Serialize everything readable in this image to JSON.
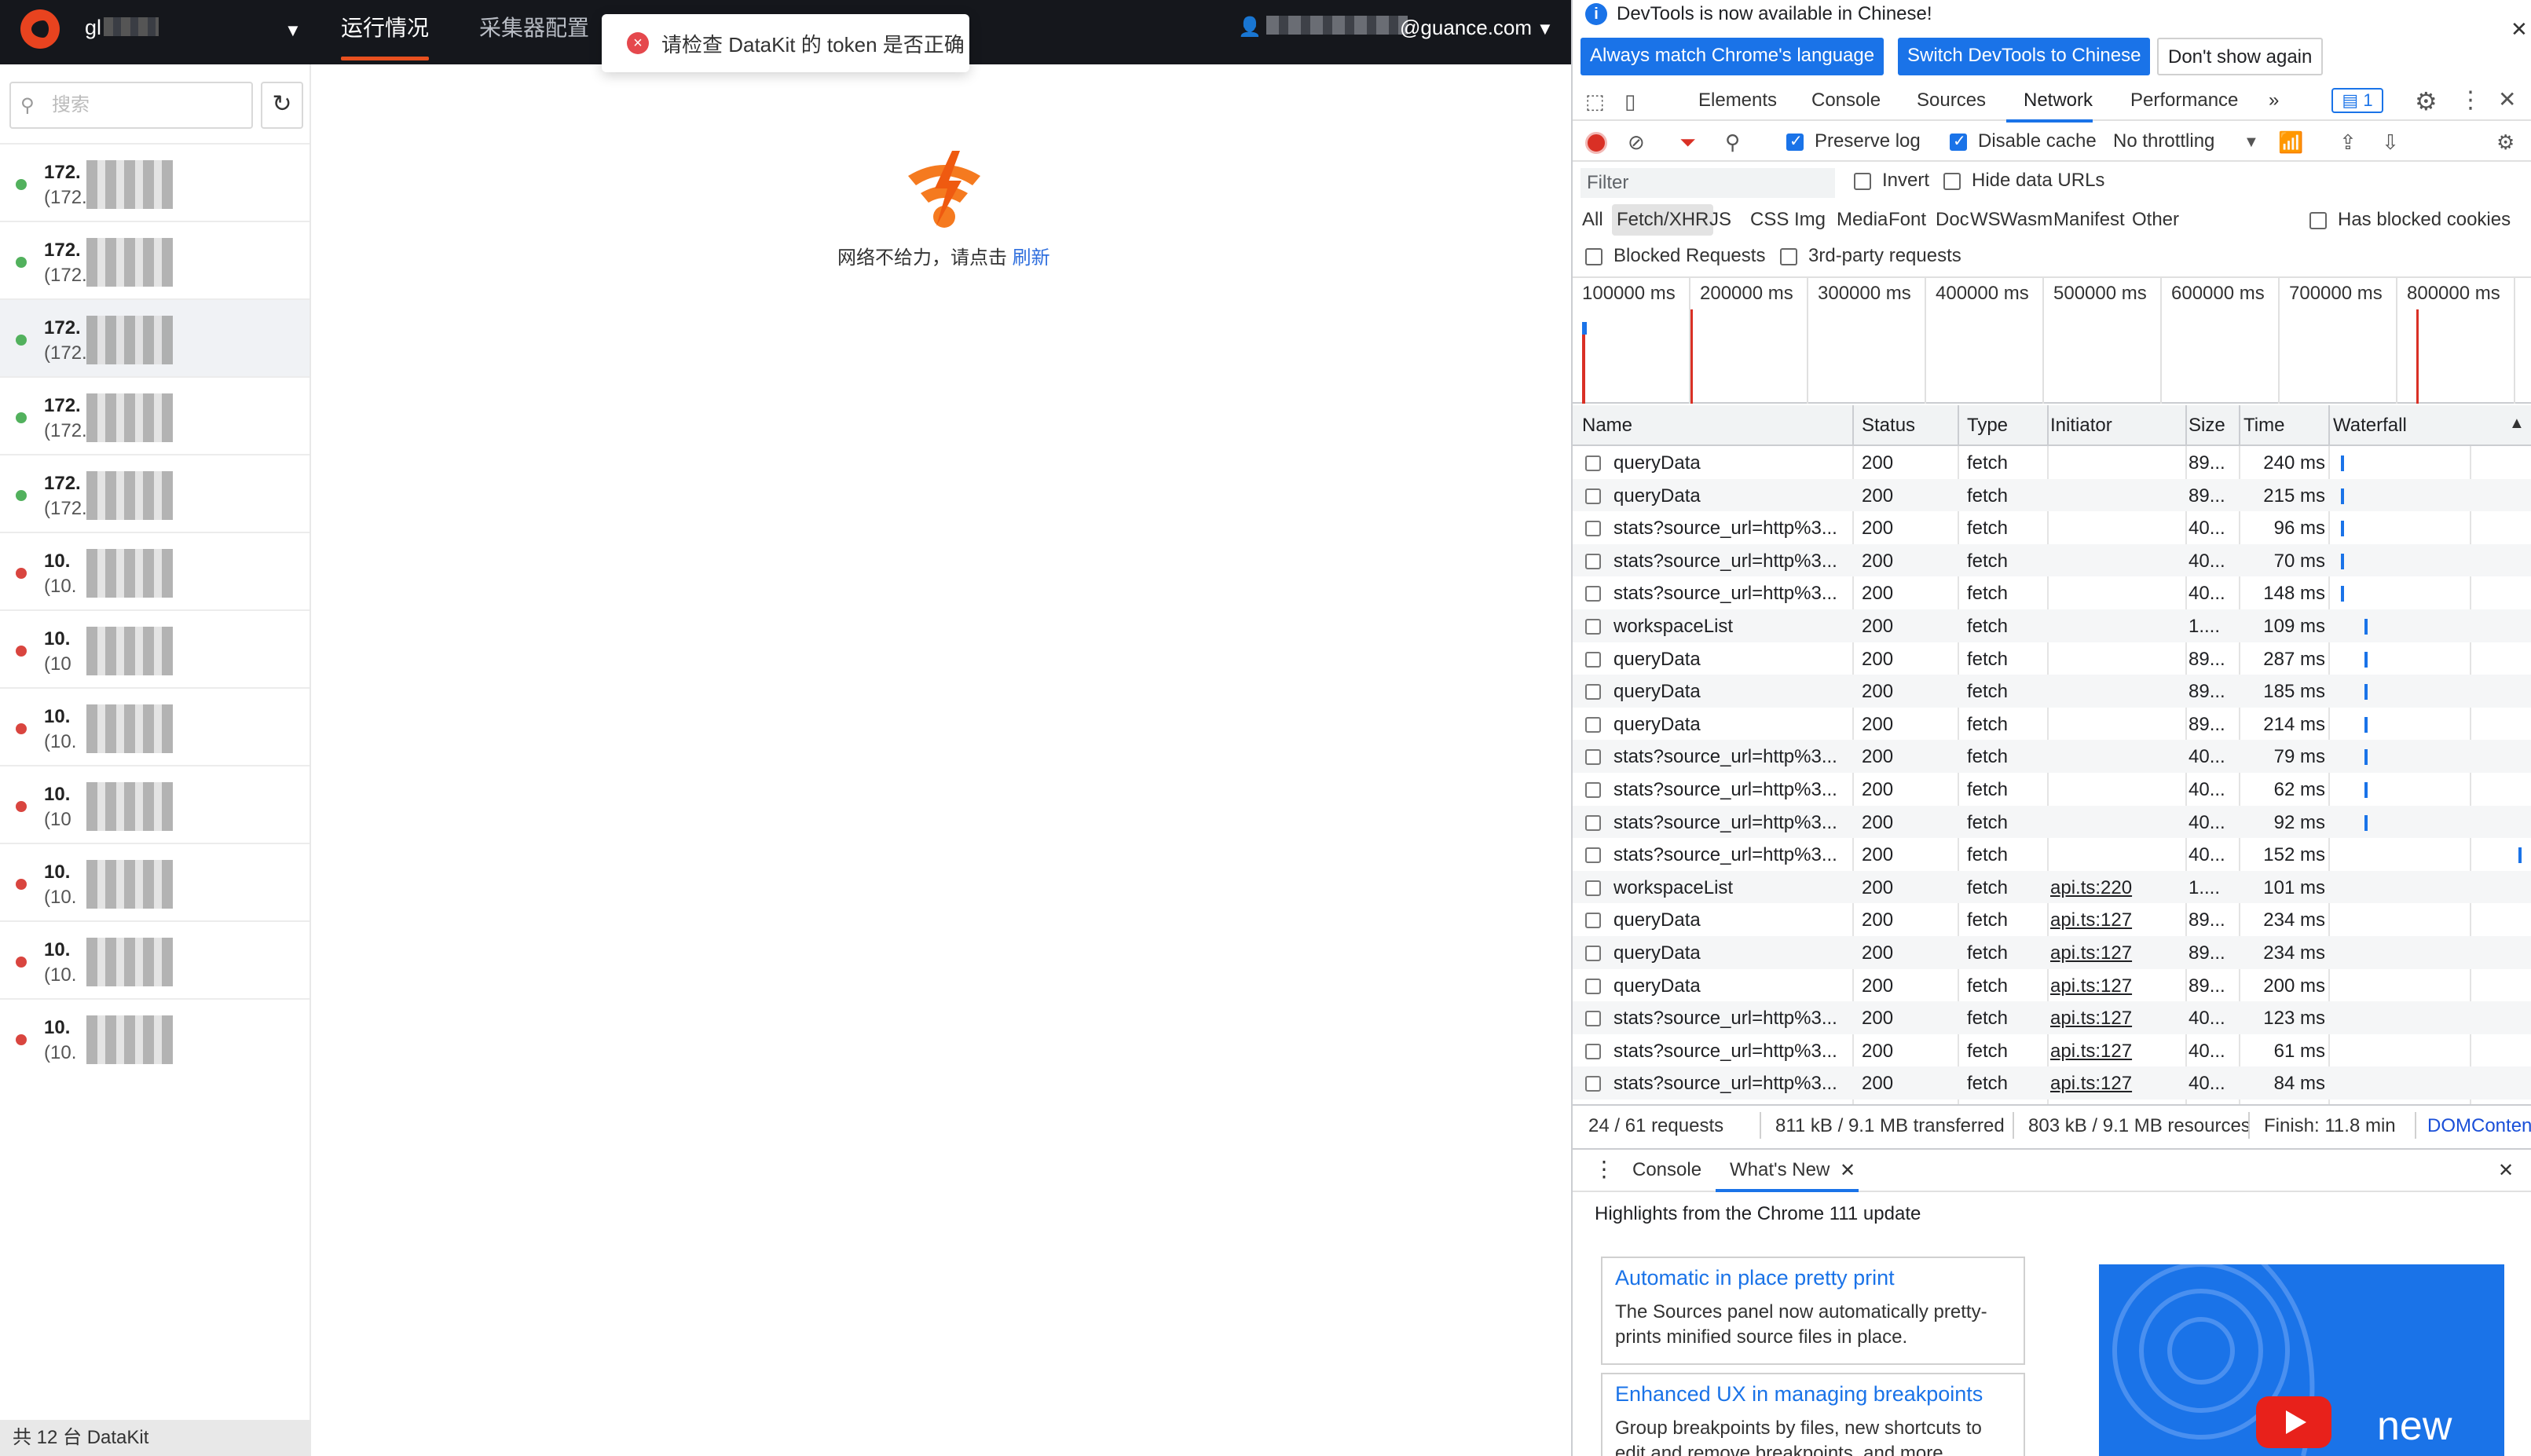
{
  "app": {
    "workspace_prefix": "gl",
    "nav": {
      "tab_running": "运行情况",
      "tab_collector": "采集器配置"
    },
    "user_email_suffix": "@guance.com",
    "toast": "请检查 DataKit 的 token 是否正确",
    "search_placeholder": "搜索",
    "datakits": [
      {
        "ip": "172.",
        "sub": "(172.",
        "status": "online"
      },
      {
        "ip": "172.",
        "sub": "(172.",
        "status": "online"
      },
      {
        "ip": "172.",
        "sub": "(172.",
        "status": "online"
      },
      {
        "ip": "172.",
        "sub": "(172.",
        "status": "online"
      },
      {
        "ip": "172.",
        "sub": "(172.",
        "status": "online"
      },
      {
        "ip": "10.",
        "sub": "(10.",
        "status": "offline"
      },
      {
        "ip": "10.",
        "sub": "(10",
        "status": "offline"
      },
      {
        "ip": "10.",
        "sub": "(10.",
        "status": "offline"
      },
      {
        "ip": "10.",
        "sub": "(10",
        "status": "offline"
      },
      {
        "ip": "10.",
        "sub": "(10.",
        "status": "offline"
      },
      {
        "ip": "10.",
        "sub": "(10.",
        "status": "offline"
      },
      {
        "ip": "10.",
        "sub": "(10.",
        "status": "offline"
      }
    ],
    "footer": "共 12 台 DataKit",
    "error_text": "网络不给力，请点击 ",
    "error_link": "刷新",
    "colors": {
      "online": "#52b15d",
      "offline": "#d9453f",
      "accent": "#e8501f"
    }
  },
  "devtools": {
    "info": {
      "message": "DevTools is now available in Chinese!",
      "btn_match": "Always match Chrome's language",
      "btn_switch": "Switch DevTools to Chinese",
      "btn_dismiss": "Don't show again"
    },
    "tabs": [
      "Elements",
      "Console",
      "Sources",
      "Network",
      "Performance"
    ],
    "more_tabs": "»",
    "issues_count": "1",
    "toolbar": {
      "preserve_log": "Preserve log",
      "disable_cache": "Disable cache",
      "throttling": "No throttling"
    },
    "filter_placeholder": "Filter",
    "invert": "Invert",
    "hide_data_urls": "Hide data URLs",
    "types": [
      "All",
      "Fetch/XHR",
      "JS",
      "CSS",
      "Img",
      "Media",
      "Font",
      "Doc",
      "WS",
      "Wasm",
      "Manifest",
      "Other"
    ],
    "has_blocked_cookies": "Has blocked cookies",
    "blocked_requests": "Blocked Requests",
    "third_party": "3rd-party requests",
    "timeline_labels": [
      "100000 ms",
      "200000 ms",
      "300000 ms",
      "400000 ms",
      "500000 ms",
      "600000 ms",
      "700000 ms",
      "800000 ms"
    ],
    "columns": {
      "name": "Name",
      "status": "Status",
      "type": "Type",
      "initiator": "Initiator",
      "size": "Size",
      "time": "Time",
      "waterfall": "Waterfall"
    },
    "requests": [
      {
        "name": "queryData",
        "status": "200",
        "type": "fetch",
        "initiator": "",
        "size": "89...",
        "time": "240 ms",
        "wf": 0
      },
      {
        "name": "queryData",
        "status": "200",
        "type": "fetch",
        "initiator": "",
        "size": "89...",
        "time": "215 ms",
        "wf": 0
      },
      {
        "name": "stats?source_url=http%3...",
        "status": "200",
        "type": "fetch",
        "initiator": "",
        "size": "40...",
        "time": "96 ms",
        "wf": 0
      },
      {
        "name": "stats?source_url=http%3...",
        "status": "200",
        "type": "fetch",
        "initiator": "",
        "size": "40...",
        "time": "70 ms",
        "wf": 0
      },
      {
        "name": "stats?source_url=http%3...",
        "status": "200",
        "type": "fetch",
        "initiator": "",
        "size": "40...",
        "time": "148 ms",
        "wf": 0
      },
      {
        "name": "workspaceList",
        "status": "200",
        "type": "fetch",
        "initiator": "",
        "size": "1....",
        "time": "109 ms",
        "wf": 1
      },
      {
        "name": "queryData",
        "status": "200",
        "type": "fetch",
        "initiator": "",
        "size": "89...",
        "time": "287 ms",
        "wf": 1
      },
      {
        "name": "queryData",
        "status": "200",
        "type": "fetch",
        "initiator": "",
        "size": "89...",
        "time": "185 ms",
        "wf": 1
      },
      {
        "name": "queryData",
        "status": "200",
        "type": "fetch",
        "initiator": "",
        "size": "89...",
        "time": "214 ms",
        "wf": 1
      },
      {
        "name": "stats?source_url=http%3...",
        "status": "200",
        "type": "fetch",
        "initiator": "",
        "size": "40...",
        "time": "79 ms",
        "wf": 1
      },
      {
        "name": "stats?source_url=http%3...",
        "status": "200",
        "type": "fetch",
        "initiator": "",
        "size": "40...",
        "time": "62 ms",
        "wf": 1
      },
      {
        "name": "stats?source_url=http%3...",
        "status": "200",
        "type": "fetch",
        "initiator": "",
        "size": "40...",
        "time": "92 ms",
        "wf": 1
      },
      {
        "name": "stats?source_url=http%3...",
        "status": "200",
        "type": "fetch",
        "initiator": "",
        "size": "40...",
        "time": "152 ms",
        "wf": 2
      },
      {
        "name": "workspaceList",
        "status": "200",
        "type": "fetch",
        "initiator": "api.ts:220",
        "size": "1....",
        "time": "101 ms",
        "wf": 3
      },
      {
        "name": "queryData",
        "status": "200",
        "type": "fetch",
        "initiator": "api.ts:127",
        "size": "89...",
        "time": "234 ms",
        "wf": 3
      },
      {
        "name": "queryData",
        "status": "200",
        "type": "fetch",
        "initiator": "api.ts:127",
        "size": "89...",
        "time": "234 ms",
        "wf": 3
      },
      {
        "name": "queryData",
        "status": "200",
        "type": "fetch",
        "initiator": "api.ts:127",
        "size": "89...",
        "time": "200 ms",
        "wf": 3
      },
      {
        "name": "stats?source_url=http%3...",
        "status": "200",
        "type": "fetch",
        "initiator": "api.ts:127",
        "size": "40...",
        "time": "123 ms",
        "wf": 3
      },
      {
        "name": "stats?source_url=http%3...",
        "status": "200",
        "type": "fetch",
        "initiator": "api.ts:127",
        "size": "40...",
        "time": "61 ms",
        "wf": 3
      },
      {
        "name": "stats?source_url=http%3...",
        "status": "200",
        "type": "fetch",
        "initiator": "api.ts:127",
        "size": "40...",
        "time": "84 ms",
        "wf": 3
      }
    ],
    "status_bar": {
      "requests": "24 / 61 requests",
      "transferred": "811 kB / 9.1 MB transferred",
      "resources": "803 kB / 9.1 MB resources",
      "finish": "Finish: 11.8 min",
      "dom": "DOMConten"
    },
    "drawer": {
      "console": "Console",
      "whats_new": "What's New"
    },
    "whats_new": {
      "highlights": "Highlights from the Chrome 111 update",
      "cards": [
        {
          "title": "Automatic in place pretty print",
          "body": "The Sources panel now automatically pretty-prints minified source files in place."
        },
        {
          "title": "Enhanced UX in managing breakpoints",
          "body": "Group breakpoints by files, new shortcuts to edit and remove breakpoints, and more."
        }
      ],
      "video_label": "new"
    }
  }
}
